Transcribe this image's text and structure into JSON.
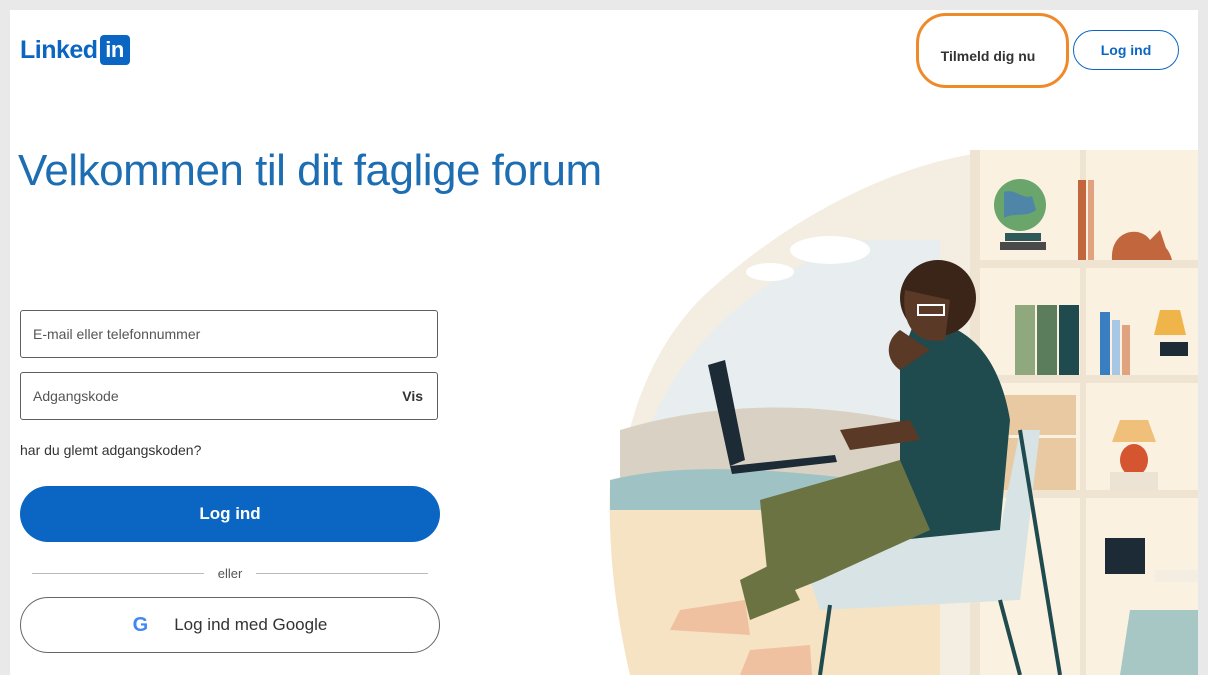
{
  "header": {
    "logo_text": "Linked",
    "logo_badge": "in",
    "signup_label": "Tilmeld dig nu",
    "login_label": "Log ind"
  },
  "main": {
    "headline": "Velkommen til dit faglige forum",
    "email_placeholder": "E-mail eller telefonnummer",
    "password_placeholder": "Adgangskode",
    "show_label": "Vis",
    "forgot_label": "har du glemt adgangskoden?",
    "login_label": "Log ind",
    "divider_label": "eller",
    "google_icon_text": "G",
    "google_label": "Log ind med Google"
  },
  "colors": {
    "brand": "#0a66c2",
    "highlight": "#ef8a2b"
  }
}
